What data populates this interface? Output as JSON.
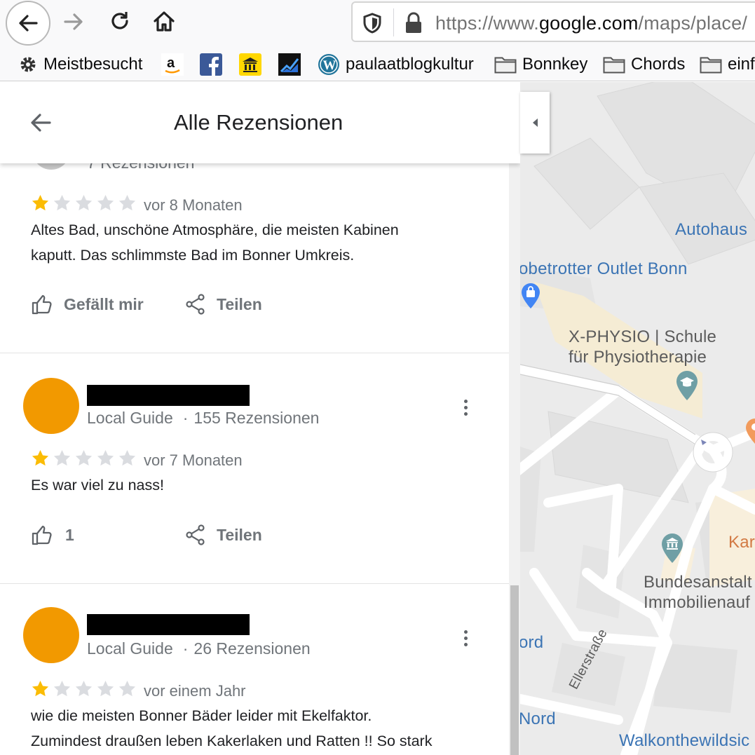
{
  "browser": {
    "url_prefix": "https://www.",
    "url_host": "google.com",
    "url_path": "/maps/place/",
    "bookmarks": [
      {
        "label": "Meistbesucht",
        "icon": "gear-icon"
      },
      {
        "label": "",
        "icon": "amazon-icon"
      },
      {
        "label": "",
        "icon": "facebook-icon"
      },
      {
        "label": "",
        "icon": "bank-icon"
      },
      {
        "label": "",
        "icon": "chart-icon"
      },
      {
        "label": "paulaatblogkultur",
        "icon": "wordpress-icon"
      },
      {
        "label": "Bonnkey",
        "icon": "folder-icon"
      },
      {
        "label": "Chords",
        "icon": "folder-icon"
      },
      {
        "label": "einf",
        "icon": "folder-icon"
      }
    ]
  },
  "panel": {
    "title": "Alle Rezensionen",
    "peek_text": "7 Rezensionen"
  },
  "reviews": [
    {
      "rating": 1,
      "date": "vor 8 Monaten",
      "text_lines": [
        "Altes Bad,  unschöne Atmosphäre, die meisten Kabinen",
        "kaputt. Das schlimmste Bad im Bonner Umkreis."
      ],
      "like_label": "Gefällt mir",
      "share_label": "Teilen"
    },
    {
      "badge": "Local Guide",
      "dot": "·",
      "count": "155 Rezensionen",
      "rating": 1,
      "date": "vor 7 Monaten",
      "text_lines": [
        "Es war viel zu nass!"
      ],
      "like_label": "1",
      "share_label": "Teilen"
    },
    {
      "badge": "Local Guide",
      "dot": "·",
      "count": "26 Rezensionen",
      "rating": 1,
      "date": "vor einem Jahr",
      "text_lines": [
        "wie die meisten Bonner Bäder leider mit Ekelfaktor.",
        "Zumindest draußen leben Kakerlaken und Ratten !! So stark"
      ]
    }
  ],
  "map": {
    "labels": {
      "autohaus": "Autohaus",
      "outlet": "obetrotter Outlet Bonn",
      "physio1": "X-PHYSIO | Schule",
      "physio2": "für Physiotherapie",
      "kar": "Kar",
      "bund1": "Bundesanstalt",
      "bund2": "Immobilienauf",
      "ord": "ord",
      "nord": "Nord",
      "ellerstrasse": "Ellerstraße",
      "walkon": "Walkonthewildsic"
    }
  },
  "colors": {
    "star_filled": "#fbbc04",
    "star_empty": "#dadce0",
    "avatar": "#f29900",
    "map_blue_label": "#3b74b4"
  }
}
